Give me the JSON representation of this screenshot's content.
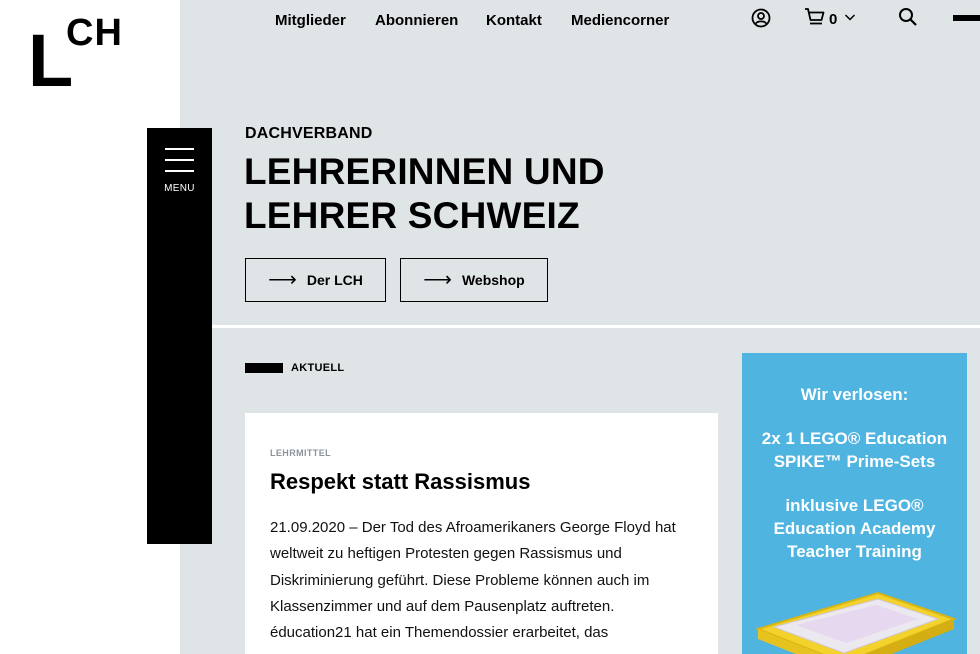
{
  "logo": {
    "big": "L",
    "small": "CH"
  },
  "nav": {
    "links": [
      "Mitglieder",
      "Abonnieren",
      "Kontakt",
      "Mediencorner"
    ],
    "cart_count": "0",
    "icons": [
      "user-icon",
      "cart-icon",
      "chevron-down-icon",
      "search-icon"
    ]
  },
  "menu": {
    "label": "MENU"
  },
  "hero": {
    "kicker": "DACHVERBAND",
    "title_line1": "LEHRERINNEN UND",
    "title_line2": "LEHRER SCHWEIZ",
    "buttons": [
      {
        "arrow": "⟶",
        "label": "Der LCH"
      },
      {
        "arrow": "⟶",
        "label": "Webshop"
      }
    ]
  },
  "section": {
    "label": "AKTUELL"
  },
  "article": {
    "category": "LEHRMITTEL",
    "title": "Respekt statt Rassismus",
    "text": "21.09.2020 – Der Tod des Afroamerikaners George Floyd hat weltweit zu heftigen Protesten gegen Rassismus und Diskriminierung geführt. Diese Probleme können auch im Klassenzimmer und auf dem Pausenplatz auftreten. éducation21 hat ein Themendossier erarbeitet, das"
  },
  "promo": {
    "line1": "Wir verlosen:",
    "line2a": "2x 1 LEGO® Education",
    "line2b": "SPIKE™ Prime-Sets",
    "line3a": "inklusive LEGO®",
    "line3b": "Education Academy",
    "line3c": "Teacher Training"
  },
  "colors": {
    "page_grey": "#dfe4e6",
    "promo_blue": "#4fb4e0",
    "menu_black": "#000000"
  }
}
